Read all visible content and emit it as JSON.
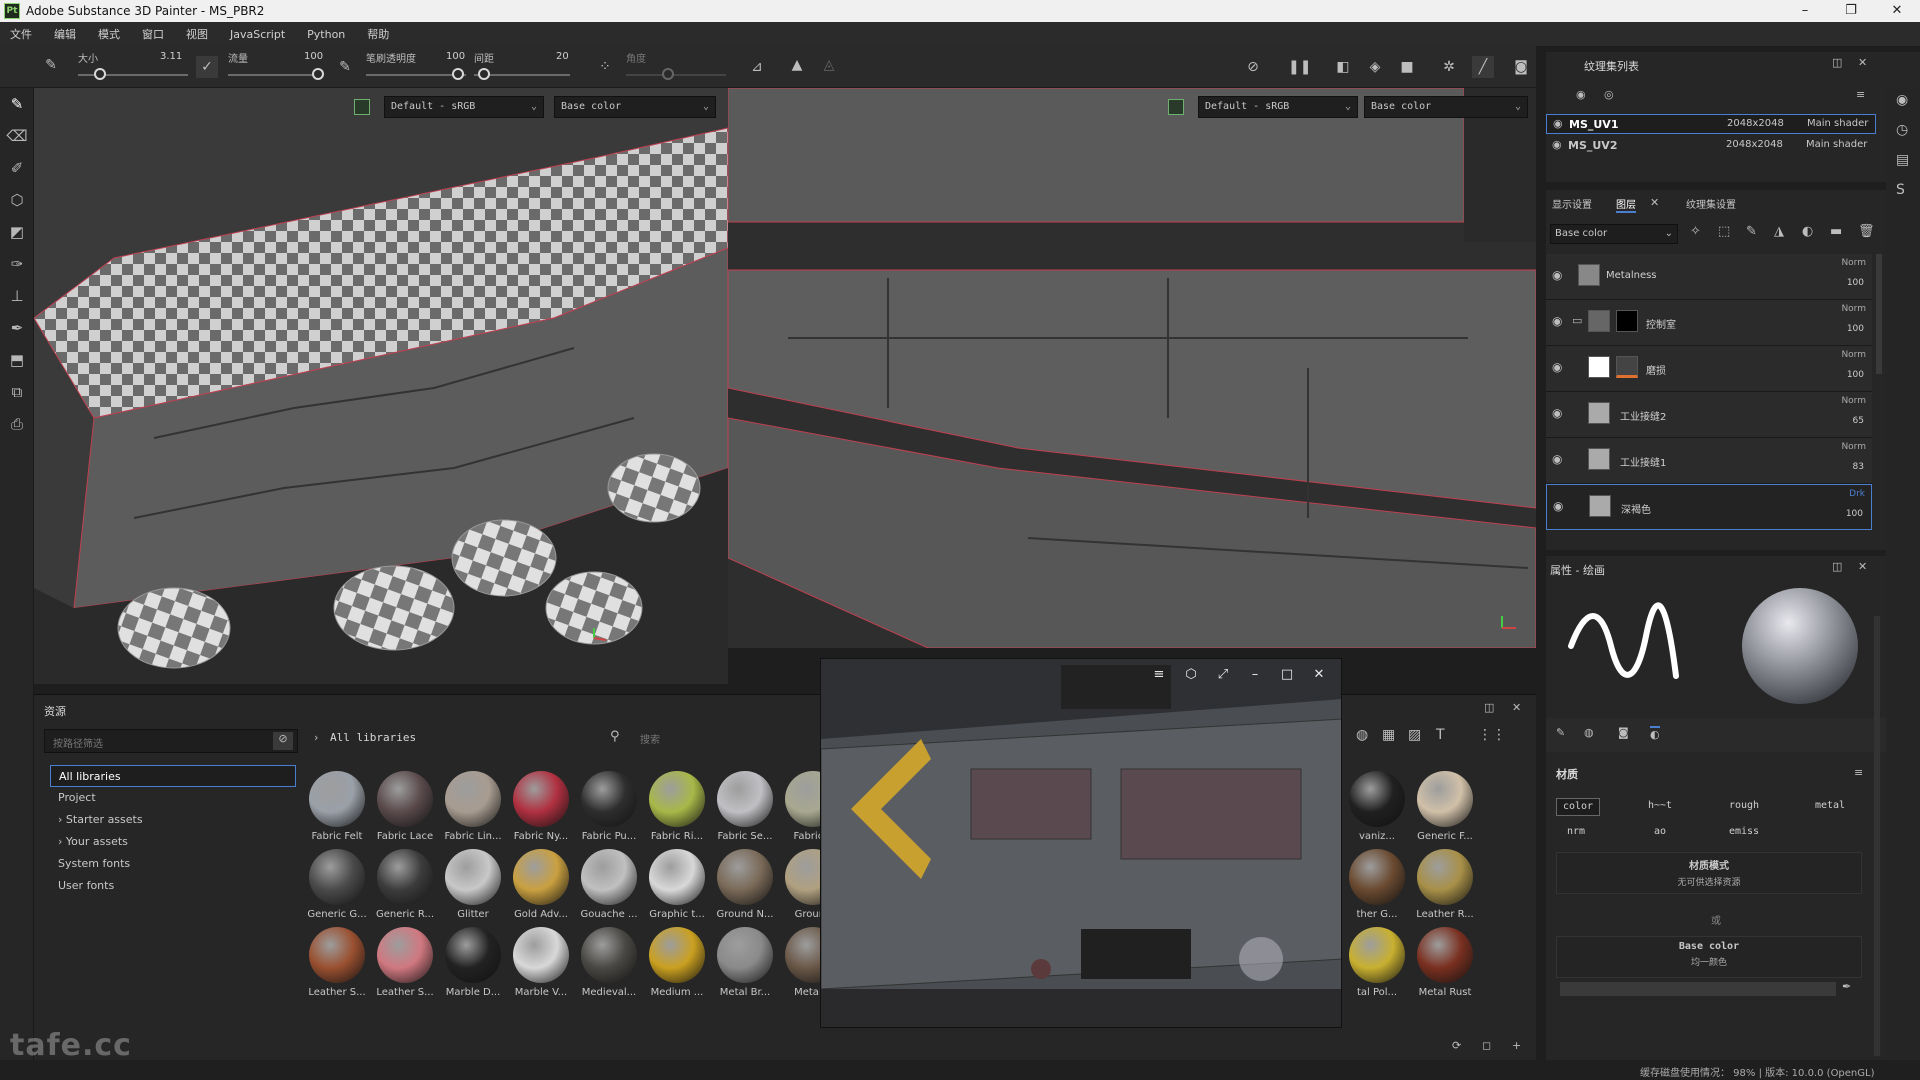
{
  "window": {
    "title": "Adobe Substance 3D Painter - MS_PBR2",
    "app_badge": "Pt",
    "minimize": "–",
    "maximize": "❐",
    "close": "✕"
  },
  "menu": [
    "文件",
    "编辑",
    "模式",
    "窗口",
    "视图",
    "JavaScript",
    "Python",
    "帮助"
  ],
  "tool_options": {
    "size_label": "大小",
    "size_value": "3.11",
    "flow_label": "流量",
    "flow_value": "100",
    "opacity_label": "笔刷透明度",
    "opacity_value": "100",
    "spacing_label": "间距",
    "spacing_value": "20",
    "angle_label": "角度"
  },
  "viewport3d": {
    "colorspace": "Default - sRGB",
    "channel": "Base color"
  },
  "viewport2d": {
    "colorspace": "Default - sRGB",
    "channel": "Base color"
  },
  "texture_set_list": {
    "title": "纹理集列表",
    "rows": [
      {
        "name": "MS_UV1",
        "res": "2048x2048",
        "shader": "Main shader"
      },
      {
        "name": "MS_UV2",
        "res": "2048x2048",
        "shader": "Main shader"
      }
    ]
  },
  "layers_panel": {
    "tabs": [
      "显示设置",
      "图层",
      "纹理集设置"
    ],
    "channel_select": "Base color",
    "layers": [
      {
        "name": "Metalness",
        "blend": "Norm",
        "opacity": "100"
      },
      {
        "name": "控制室",
        "blend": "Norm",
        "opacity": "100"
      },
      {
        "name": "磨损",
        "blend": "Norm",
        "opacity": "100"
      },
      {
        "name": "工业接缝2",
        "blend": "Norm",
        "opacity": "65"
      },
      {
        "name": "工业接缝1",
        "blend": "Norm",
        "opacity": "83"
      },
      {
        "name": "深褐色",
        "blend": "Drk",
        "opacity": "100"
      }
    ]
  },
  "properties": {
    "title": "属性 - 绘画",
    "section": "材质",
    "channels": [
      "color",
      "h~~t",
      "rough",
      "metal",
      "nrm",
      "ao",
      "emiss"
    ],
    "material_mode_label": "材质模式",
    "material_mode_value": "无可供选择资源",
    "or_label": "或",
    "base_color_label": "Base color",
    "base_color_value": "均一颜色"
  },
  "assets": {
    "title": "资源",
    "filter_placeholder": "按路径筛选",
    "breadcrumb": "All libraries",
    "search_placeholder": "搜索",
    "tree": [
      "All libraries",
      "Project",
      "Starter assets",
      "Your assets",
      "System fonts",
      "User fonts"
    ],
    "materials_row1": [
      "Fabric Felt",
      "Fabric Lace",
      "Fabric Lin...",
      "Fabric Ny...",
      "Fabric Pu...",
      "Fabric Ri...",
      "Fabric Se...",
      "Fabric T"
    ],
    "materials_row2": [
      "Generic G...",
      "Generic R...",
      "Glitter",
      "Gold Adv...",
      "Gouache ...",
      "Graphic t...",
      "Ground N...",
      "Ground"
    ],
    "materials_row3": [
      "Leather S...",
      "Leather S...",
      "Marble D...",
      "Marble V...",
      "Medieval...",
      "Medium ...",
      "Metal Br...",
      "Metal C"
    ],
    "materials_right": [
      "vaniz...",
      "Generic F...",
      "ther G...",
      "Leather R...",
      "tal Pol...",
      "Metal Rust"
    ],
    "colors": {
      "row1": [
        "#9aa0a8",
        "#5a4a4c",
        "#a89c90",
        "#b03040",
        "#2e2e2e",
        "#a8b848",
        "#c0c0c4",
        "#a8a890"
      ],
      "row2": [
        "#4a4a4a",
        "#3c3c3c",
        "#c8c8c8",
        "#caa040",
        "#c0c0c0",
        "#d8d8d8",
        "#7a6a58",
        "#b0a080"
      ],
      "row3": [
        "#9a5030",
        "#d07880",
        "#222222",
        "#d8d8d8",
        "#4a4844",
        "#caa020",
        "#8a8a8a",
        "#6a5848"
      ],
      "right": [
        "#202020",
        "#d0c0a8",
        "#6a4a30",
        "#a89048",
        "#c8b030",
        "#7a3020"
      ]
    }
  },
  "status": {
    "text": "缓存磁盘使用情况：  98%  |  版本: 10.0.0 (OpenGL)"
  },
  "watermark": "tafe.cc"
}
